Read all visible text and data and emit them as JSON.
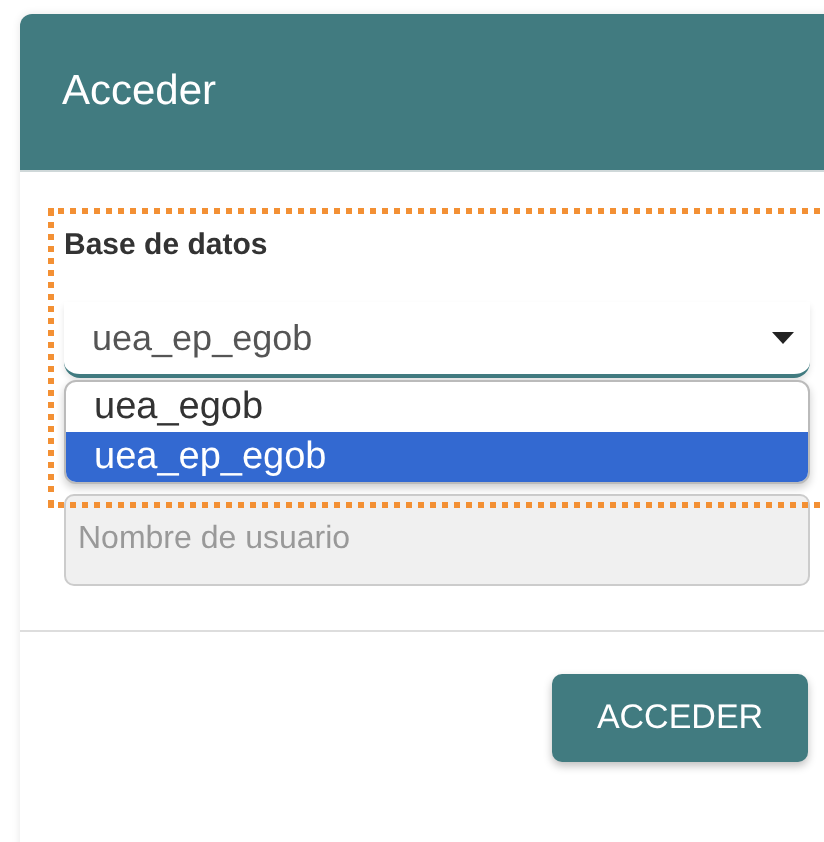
{
  "dialog": {
    "title": "Acceder"
  },
  "database": {
    "label": "Base de datos",
    "value": "uea_ep_egob",
    "expanded": true,
    "options": [
      {
        "label": "uea_egob",
        "selected": false
      },
      {
        "label": "uea_ep_egob",
        "selected": true
      }
    ]
  },
  "username": {
    "placeholder": "Nombre de usuario"
  },
  "highlight": true,
  "buttons": [
    "ACCEDER"
  ]
}
